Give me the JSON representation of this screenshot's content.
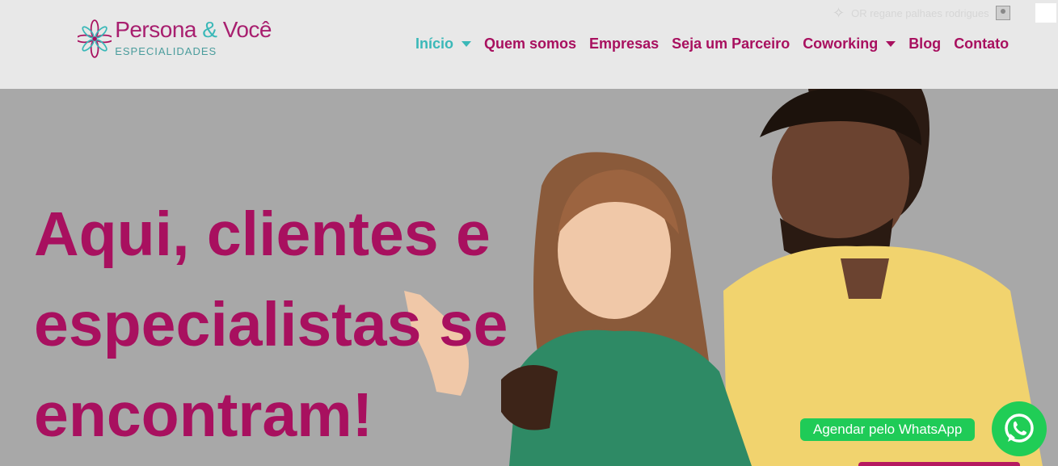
{
  "brand": {
    "name_part1": "Persona",
    "name_amp": " & ",
    "name_part2": "Você",
    "subtitle": "ESPECIALIDADES",
    "colors": {
      "magenta": "#a8105f",
      "teal": "#3ab8b8"
    }
  },
  "topbar": {
    "sparkle_icon": "sparkle-icon",
    "user_name": "OR regane palhaes rodrigues",
    "avatar_icon": "user-avatar-icon"
  },
  "nav": {
    "items": [
      {
        "label": "Início",
        "has_dropdown": true,
        "active": true
      },
      {
        "label": "Quem somos",
        "has_dropdown": false
      },
      {
        "label": "Empresas",
        "has_dropdown": false
      },
      {
        "label": "Seja um Parceiro",
        "has_dropdown": false
      },
      {
        "label": "Coworking",
        "has_dropdown": true
      },
      {
        "label": "Blog",
        "has_dropdown": false
      },
      {
        "label": "Contato",
        "has_dropdown": false
      }
    ]
  },
  "hero": {
    "line1": "Aqui, clientes e",
    "line2": "especialistas se",
    "line3": "encontram!",
    "background": "#a8a8a8"
  },
  "whatsapp": {
    "label": "Agendar pelo WhatsApp",
    "icon": "whatsapp-icon",
    "color": "#20cd56"
  }
}
